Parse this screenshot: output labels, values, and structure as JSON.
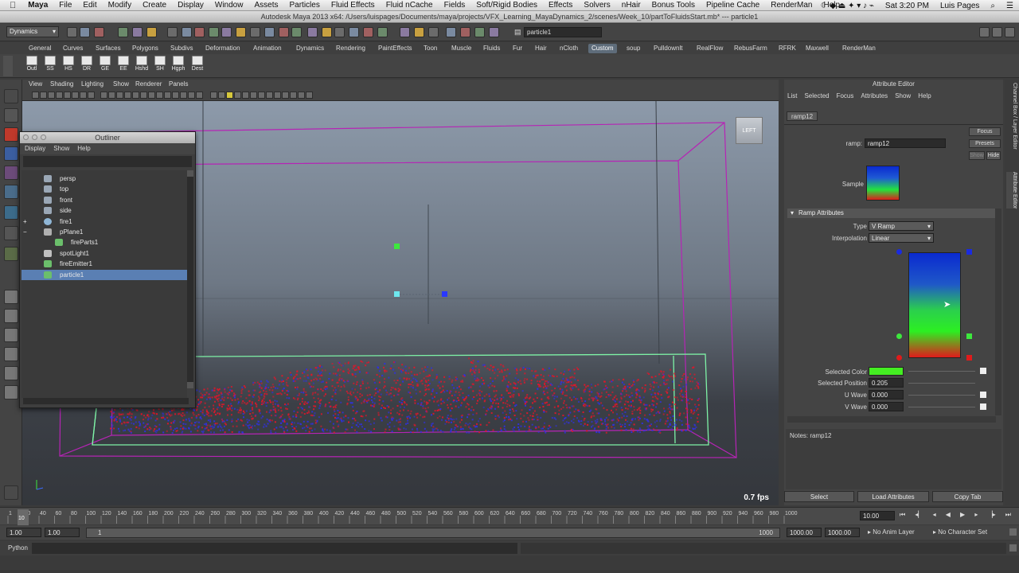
{
  "menubar": {
    "app": "Maya",
    "items": [
      "File",
      "Edit",
      "Modify",
      "Create",
      "Display",
      "Window",
      "Assets",
      "Particles",
      "Fluid Effects",
      "Fluid nCache",
      "Fields",
      "Soft/Rigid Bodies",
      "Effects",
      "Solvers",
      "nHair",
      "Bonus Tools",
      "Pipeline Cache",
      "RenderMan",
      "Help"
    ],
    "clock": "Sat 3:20 PM",
    "user": "Luis Pages"
  },
  "window_title": "Autodesk Maya 2013 x64: /Users/luispages/Documents/maya/projects/VFX_Learning_MayaDynamics_2/scenes/Week_10/partToFluidsStart.mb*  ---  particle1",
  "statusline": {
    "mode": "Dynamics",
    "selection_field": "particle1"
  },
  "shelf": {
    "tabs": [
      "General",
      "Curves",
      "Surfaces",
      "Polygons",
      "Subdivs",
      "Deformation",
      "Animation",
      "Dynamics",
      "Rendering",
      "PaintEffects",
      "Toon",
      "Muscle",
      "Fluids",
      "Fur",
      "Hair",
      "nCloth",
      "Custom",
      "soup",
      "Pulldownlt",
      "RealFlow",
      "RebusFarm",
      "RFRK",
      "Maxwell",
      "RenderMan"
    ],
    "active_tab": "Custom",
    "buttons": [
      "Outl",
      "SS",
      "HS",
      "DR",
      "GE",
      "EE",
      "Hshd",
      "SH",
      "Hgph",
      "Dest"
    ]
  },
  "panel": {
    "menu": [
      "View",
      "Shading",
      "Lighting",
      "Show",
      "Renderer",
      "Panels"
    ],
    "viewcube_label": "LEFT",
    "fps": "0.7 fps"
  },
  "outliner": {
    "title": "Outliner",
    "menu": [
      "Display",
      "Show",
      "Help"
    ],
    "items": [
      {
        "label": "persp",
        "icon": "camera-icon",
        "indent": 0
      },
      {
        "label": "top",
        "icon": "camera-icon",
        "indent": 0
      },
      {
        "label": "front",
        "icon": "camera-icon",
        "indent": 0
      },
      {
        "label": "side",
        "icon": "camera-icon",
        "indent": 0
      },
      {
        "label": "fire1",
        "icon": "fluid-container-icon",
        "indent": 0,
        "expand": "+"
      },
      {
        "label": "pPlane1",
        "icon": "mesh-icon",
        "indent": 0,
        "expand": "−"
      },
      {
        "label": "fireParts1",
        "icon": "particle-icon",
        "indent": 1
      },
      {
        "label": "spotLight1",
        "icon": "spotlight-icon",
        "indent": 0
      },
      {
        "label": "fireEmitter1",
        "icon": "emitter-icon",
        "indent": 0
      },
      {
        "label": "particle1",
        "icon": "particle-icon",
        "indent": 0,
        "selected": true
      }
    ]
  },
  "attribute_editor": {
    "title": "Attribute Editor",
    "menu": [
      "List",
      "Selected",
      "Focus",
      "Attributes",
      "Show",
      "Help"
    ],
    "tab": "ramp12",
    "node_label": "ramp:",
    "node_name": "ramp12",
    "buttons": {
      "focus": "Focus",
      "presets": "Presets",
      "show": "Show",
      "hide": "Hide"
    },
    "sample_label": "Sample",
    "section": "Ramp Attributes",
    "type_label": "Type",
    "type_value": "V Ramp",
    "interp_label": "Interpolation",
    "interp_value": "Linear",
    "selected_color_label": "Selected Color",
    "selected_position_label": "Selected Position",
    "selected_position": "0.205",
    "u_wave_label": "U Wave",
    "u_wave": "0.000",
    "v_wave_label": "V Wave",
    "v_wave": "0.000",
    "notes": "Notes:  ramp12",
    "bottom": [
      "Select",
      "Load Attributes",
      "Copy Tab"
    ]
  },
  "side_tabs": [
    "Channel Box / Layer Editor",
    "Attribute Editor"
  ],
  "timeline": {
    "ticks": [
      "1",
      "20",
      "40",
      "60",
      "80",
      "100",
      "120",
      "140",
      "160",
      "180",
      "200",
      "220",
      "240",
      "260",
      "280",
      "300",
      "320",
      "340",
      "360",
      "380",
      "400",
      "420",
      "440",
      "460",
      "480",
      "500",
      "520",
      "540",
      "560",
      "580",
      "600",
      "620",
      "640",
      "660",
      "680",
      "700",
      "720",
      "740",
      "760",
      "780",
      "800",
      "820",
      "840",
      "860",
      "880",
      "900",
      "920",
      "940",
      "960",
      "980",
      "1000"
    ],
    "current_frame": "10",
    "current_field": "10.00"
  },
  "range": {
    "start": "1.00",
    "playback_start": "1.00",
    "slider_start": "1",
    "slider_end": "1000",
    "playback_end": "1000.00",
    "end": "1000.00",
    "anim_layer": "No Anim Layer",
    "character": "No Character Set"
  },
  "python_label": "Python",
  "colors": {
    "accent": "#5a7fb3",
    "selected_color_swatch": "#44ee22",
    "particles_red": "#e0162a",
    "particles_blue": "#3030e0"
  }
}
